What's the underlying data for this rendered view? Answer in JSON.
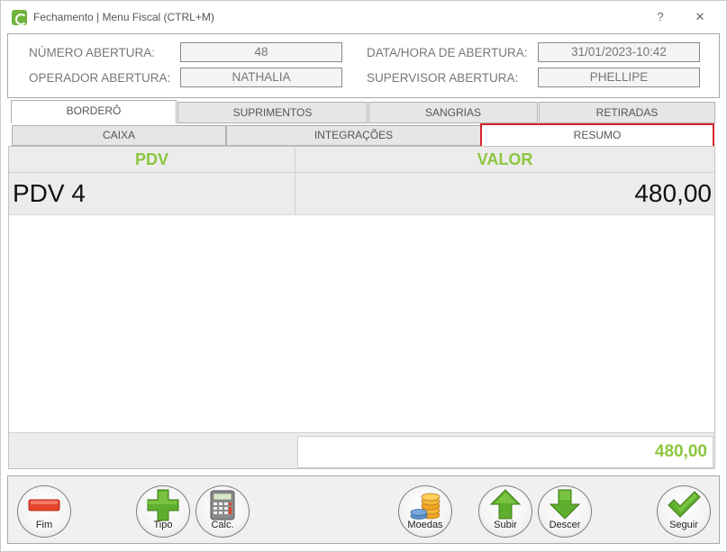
{
  "window": {
    "title": "Fechamento | Menu Fiscal (CTRL+M)",
    "help_label": "?",
    "close_label": "✕"
  },
  "header": {
    "numero_abertura_label": "NÚMERO ABERTURA:",
    "numero_abertura_value": "48",
    "data_hora_label": "DATA/HORA DE ABERTURA:",
    "data_hora_value": "31/01/2023-10:42",
    "operador_label": "OPERADOR ABERTURA:",
    "operador_value": "NATHALIA",
    "supervisor_label": "SUPERVISOR ABERTURA:",
    "supervisor_value": "PHELLIPE"
  },
  "tabs": [
    {
      "label": "BORDERÔ",
      "active": true
    },
    {
      "label": "SUPRIMENTOS",
      "active": false
    },
    {
      "label": "SANGRIAS",
      "active": false
    },
    {
      "label": "RETIRADAS",
      "active": false
    }
  ],
  "subtabs": [
    {
      "label": "CAIXA",
      "active": false
    },
    {
      "label": "INTEGRAÇÕES",
      "active": false
    },
    {
      "label": "RESUMO",
      "active": true
    }
  ],
  "grid": {
    "columns": [
      "PDV",
      "VALOR"
    ],
    "rows": [
      {
        "pdv": "PDV 4",
        "valor": "480,00"
      }
    ],
    "total": "480,00"
  },
  "toolbar": {
    "fim": "Fim",
    "tipo": "Tipo",
    "calc": "Calc.",
    "moedas": "Moedas",
    "subir": "Subir",
    "descer": "Descer",
    "seguir": "Seguir"
  },
  "colors": {
    "accent_green": "#8cc63f",
    "active_border_red": "#d9232e",
    "minus_red": "#e8442d"
  }
}
